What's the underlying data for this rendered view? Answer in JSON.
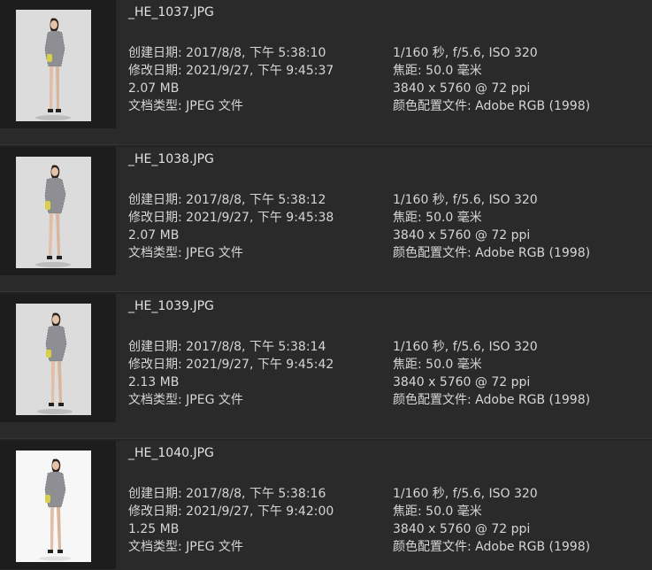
{
  "files": [
    {
      "name": "_HE_1037.JPG",
      "thumbnail_background": "#dcdcdc",
      "created": "创建日期: 2017/8/8, 下午 5:38:10",
      "modified": "修改日期: 2021/9/27, 下午 9:45:37",
      "size": "2.07 MB",
      "doc_type": "文档类型: JPEG 文件",
      "exposure": "1/160 秒,  f/5.6, ISO 320",
      "focal": "焦距: 50.0 毫米",
      "dimensions": "3840 x 5760 @ 72 ppi",
      "color_profile": "颜色配置文件: Adobe RGB (1998)"
    },
    {
      "name": "_HE_1038.JPG",
      "thumbnail_background": "#dcdcdc",
      "created": "创建日期: 2017/8/8, 下午 5:38:12",
      "modified": "修改日期: 2021/9/27, 下午 9:45:38",
      "size": "2.07 MB",
      "doc_type": "文档类型: JPEG 文件",
      "exposure": "1/160 秒,  f/5.6, ISO 320",
      "focal": "焦距: 50.0 毫米",
      "dimensions": "3840 x 5760 @ 72 ppi",
      "color_profile": "颜色配置文件: Adobe RGB (1998)"
    },
    {
      "name": "_HE_1039.JPG",
      "thumbnail_background": "#dcdcdc",
      "created": "创建日期: 2017/8/8, 下午 5:38:14",
      "modified": "修改日期: 2021/9/27, 下午 9:45:42",
      "size": "2.13 MB",
      "doc_type": "文档类型: JPEG 文件",
      "exposure": "1/160 秒,  f/5.6, ISO 320",
      "focal": "焦距: 50.0 毫米",
      "dimensions": "3840 x 5760 @ 72 ppi",
      "color_profile": "颜色配置文件: Adobe RGB (1998)"
    },
    {
      "name": "_HE_1040.JPG",
      "thumbnail_background": "#f7f7f7",
      "created": "创建日期: 2017/8/8, 下午 5:38:16",
      "modified": "修改日期: 2021/9/27, 下午 9:42:00",
      "size": "1.25 MB",
      "doc_type": "文档类型: JPEG 文件",
      "exposure": "1/160 秒,  f/5.6, ISO 320",
      "focal": "焦距: 50.0 毫米",
      "dimensions": "3840 x 5760 @ 72 ppi",
      "color_profile": "颜色配置文件: Adobe RGB (1998)"
    }
  ]
}
